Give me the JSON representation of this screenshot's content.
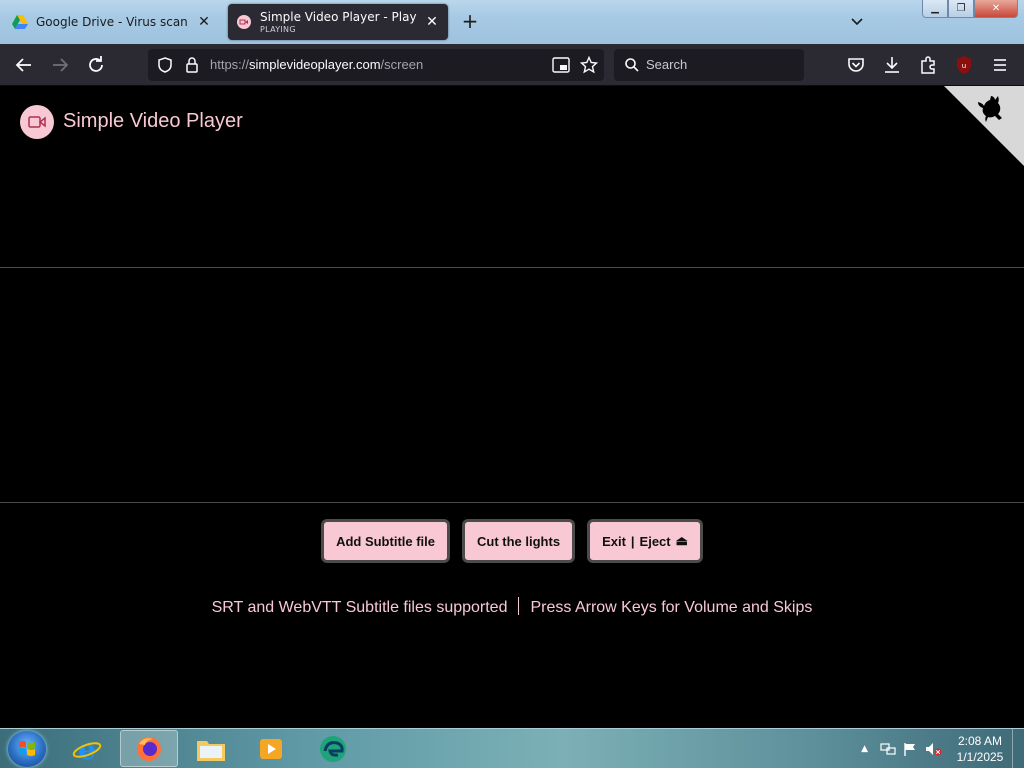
{
  "browser": {
    "tabs": [
      {
        "title": "Google Drive - Virus scan warni",
        "subtitle": "",
        "active": false
      },
      {
        "title": "Simple Video Player - Play local",
        "subtitle": "PLAYING",
        "active": true
      }
    ],
    "url_prefix": "https://",
    "url_domain": "simplevideoplayer.com",
    "url_path": "/screen",
    "search_placeholder": "Search",
    "extension_badge": "1"
  },
  "app": {
    "title": "Simple Video Player",
    "buttons": {
      "add_subtitle": "Add Subtitle file",
      "cut_lights": "Cut the lights",
      "exit": "Exit",
      "eject": "Eject"
    },
    "info_left": "SRT and WebVTT Subtitle files supported",
    "info_right": "Press Arrow Keys for Volume and Skips",
    "accent_color": "#f8c9d4"
  },
  "taskbar": {
    "time": "2:08 AM",
    "date": "1/1/2025"
  }
}
